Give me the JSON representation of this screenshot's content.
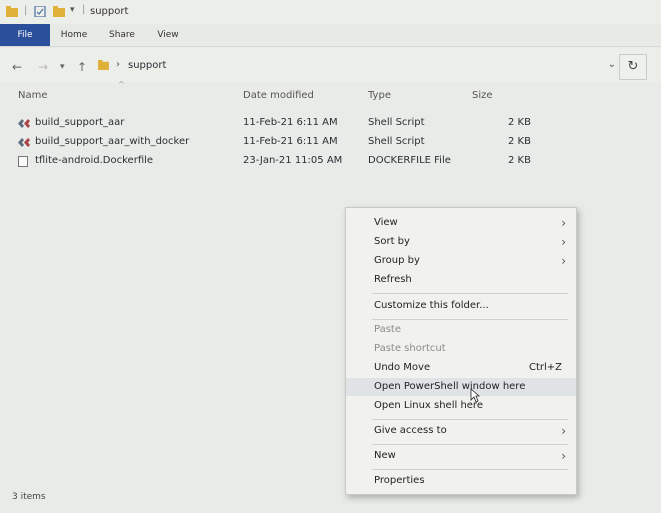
{
  "window": {
    "title": "support"
  },
  "ribbon": {
    "tabs": [
      "File",
      "Home",
      "Share",
      "View"
    ]
  },
  "address": {
    "path_segment": "support"
  },
  "columns": {
    "name": "Name",
    "date": "Date modified",
    "type": "Type",
    "size": "Size"
  },
  "files": [
    {
      "name": "build_support_aar",
      "date": "11-Feb-21 6:11 AM",
      "type": "Shell Script",
      "size": "2 KB",
      "icon": "shell-script-icon"
    },
    {
      "name": "build_support_aar_with_docker",
      "date": "11-Feb-21 6:11 AM",
      "type": "Shell Script",
      "size": "2 KB",
      "icon": "shell-script-icon"
    },
    {
      "name": "tflite-android.Dockerfile",
      "date": "23-Jan-21 11:05 AM",
      "type": "DOCKERFILE File",
      "size": "2 KB",
      "icon": "file-icon"
    }
  ],
  "status": {
    "items": "3 items"
  },
  "context_menu": {
    "view": "View",
    "sort_by": "Sort by",
    "group_by": "Group by",
    "refresh": "Refresh",
    "customize": "Customize this folder...",
    "paste": "Paste",
    "paste_shortcut": "Paste shortcut",
    "undo_move": "Undo Move",
    "undo_shortcut": "Ctrl+Z",
    "open_powershell": "Open PowerShell window here",
    "open_linux": "Open Linux shell here",
    "give_access": "Give access to",
    "new": "New",
    "properties": "Properties"
  },
  "colors": {
    "file_tab": "#2b4f9a",
    "folder": "#e0b13a",
    "menu_hover": "#dfe3e6"
  }
}
